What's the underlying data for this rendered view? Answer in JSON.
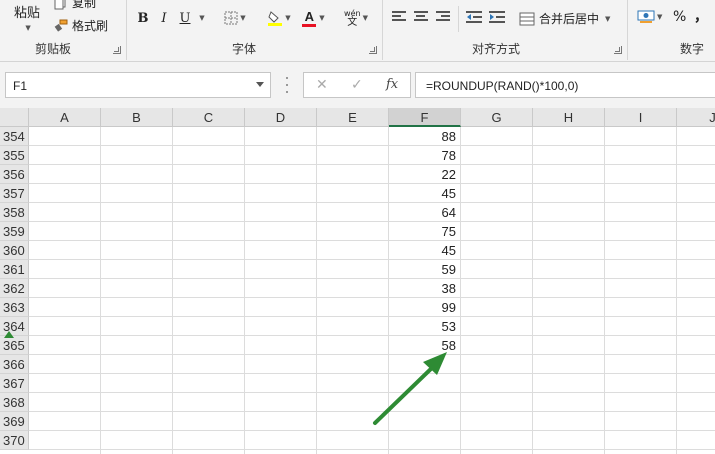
{
  "ribbon": {
    "clipboard": {
      "paste_label": "粘贴",
      "copy_label": "复制",
      "format_painter_label": "格式刷",
      "group_label": "剪贴板"
    },
    "font": {
      "bold_label": "B",
      "italic_label": "I",
      "underline_label": "U",
      "font_color_glyph": "A",
      "phonetic_top": "wén",
      "phonetic_bottom": "文",
      "group_label": "字体"
    },
    "alignment": {
      "merge_center_label": "合并后居中",
      "group_label": "对齐方式"
    },
    "number": {
      "percent_label": "%",
      "comma_label": "，",
      "group_label": "数字"
    },
    "colors": {
      "highlight": "#ffff00",
      "font_color": "#e81123"
    }
  },
  "formula_bar": {
    "name_box": "F1",
    "cancel_glyph": "✕",
    "enter_glyph": "✓",
    "fx_label": "fx",
    "formula": "=ROUNDUP(RAND()*100,0)"
  },
  "grid": {
    "columns": [
      "A",
      "B",
      "C",
      "D",
      "E",
      "F",
      "G",
      "H",
      "I",
      "J"
    ],
    "active_column": "F",
    "rows": [
      {
        "num": "354",
        "f": "88"
      },
      {
        "num": "355",
        "f": "78"
      },
      {
        "num": "356",
        "f": "22"
      },
      {
        "num": "357",
        "f": "45"
      },
      {
        "num": "358",
        "f": "64"
      },
      {
        "num": "359",
        "f": "75"
      },
      {
        "num": "360",
        "f": "45"
      },
      {
        "num": "361",
        "f": "59"
      },
      {
        "num": "362",
        "f": "38"
      },
      {
        "num": "363",
        "f": "99"
      },
      {
        "num": "364",
        "f": "53"
      },
      {
        "num": "365",
        "f": "58"
      },
      {
        "num": "366",
        "f": ""
      },
      {
        "num": "367",
        "f": ""
      },
      {
        "num": "368",
        "f": ""
      },
      {
        "num": "369",
        "f": ""
      },
      {
        "num": "370",
        "f": ""
      }
    ],
    "annotation_color": "#2e8b34"
  }
}
